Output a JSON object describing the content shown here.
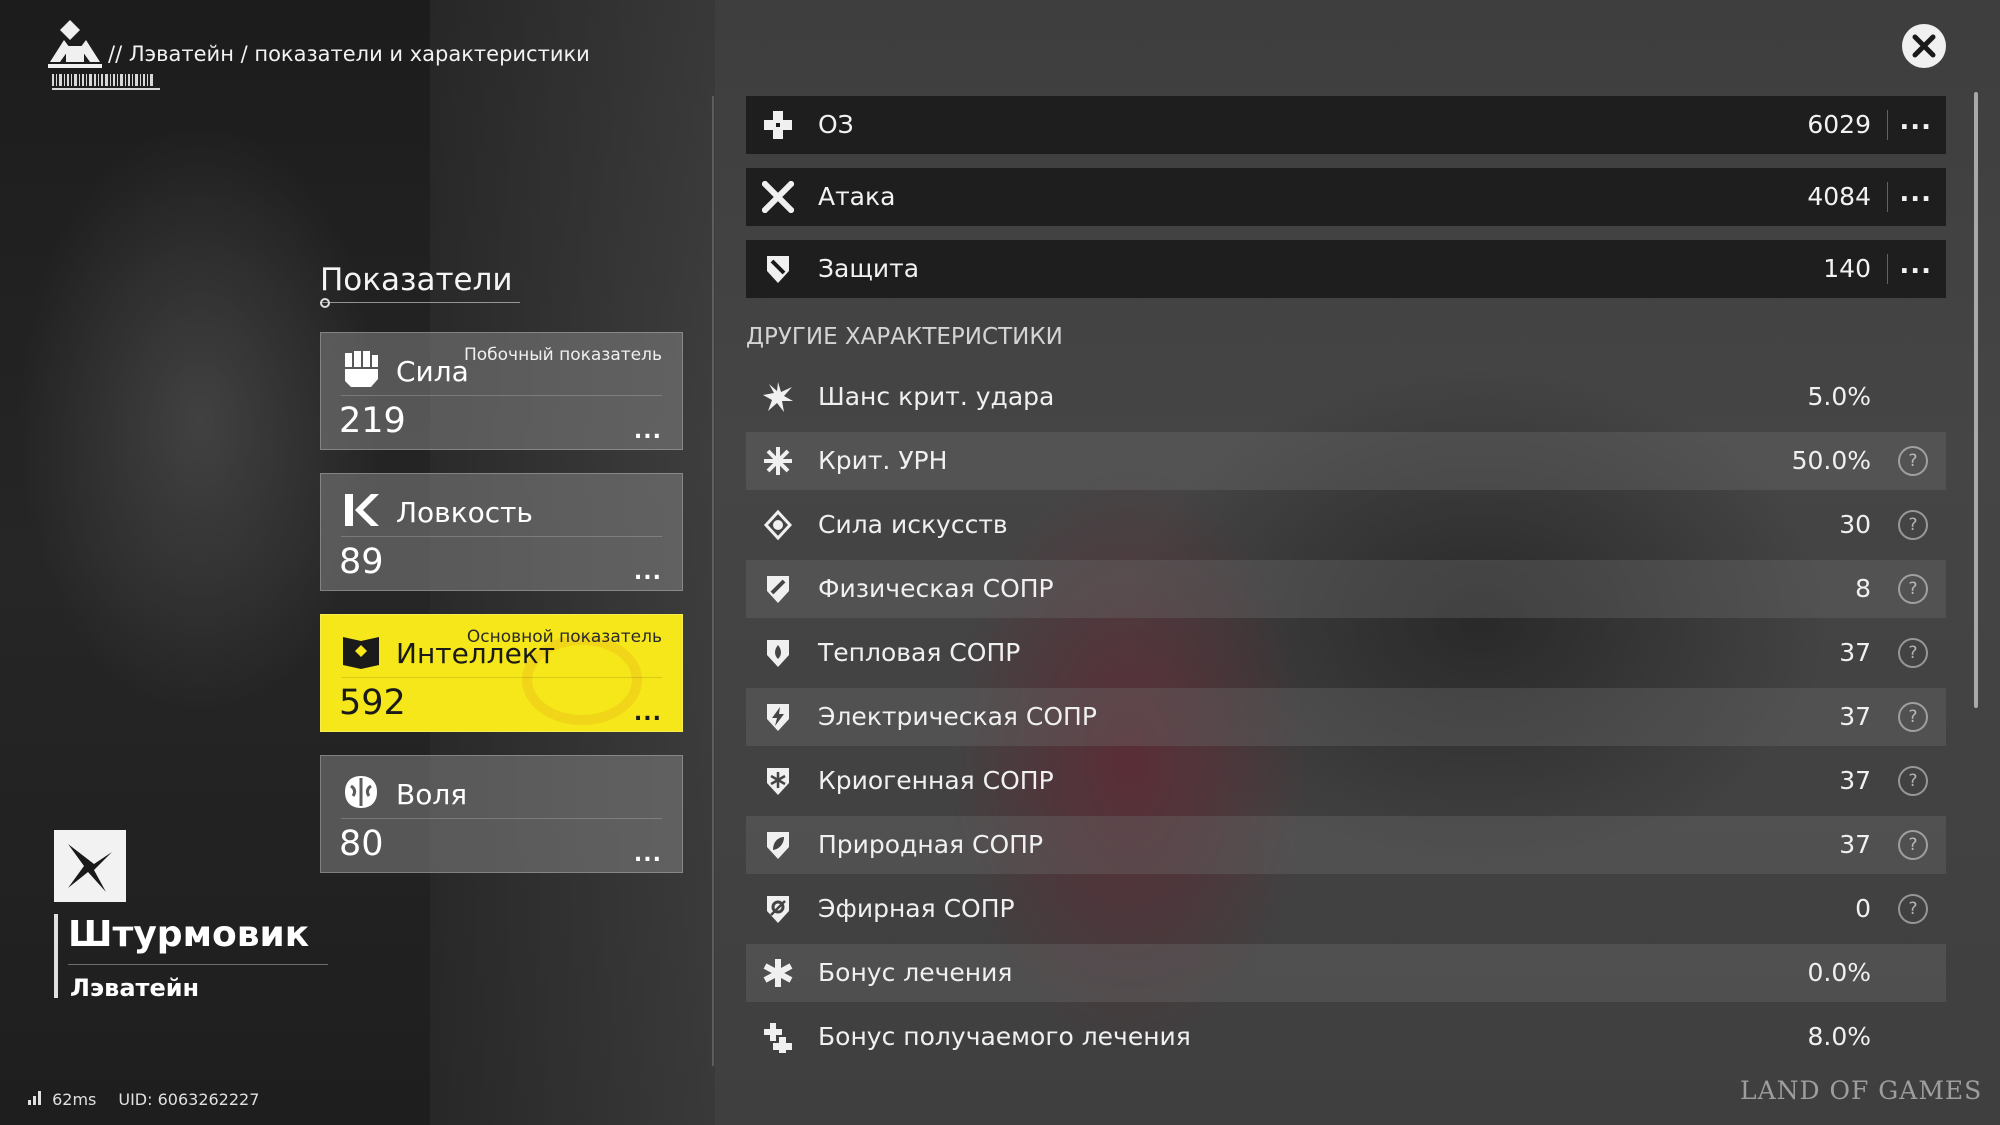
{
  "header": {
    "breadcrumb": "// Лэватейн / показатели и характеристики"
  },
  "character": {
    "class_name": "Штурмовик",
    "name": "Лэватейн"
  },
  "status_bar": {
    "ping": "62ms",
    "uid": "UID: 6063262227"
  },
  "attributes": {
    "title": "Показатели",
    "items": [
      {
        "name": "Сила",
        "value": "219",
        "tag": "Побочный показатель",
        "icon": "fist-icon",
        "more": "..."
      },
      {
        "name": "Ловкость",
        "value": "89",
        "tag": "",
        "icon": "agility-icon",
        "more": "..."
      },
      {
        "name": "Интеллект",
        "value": "592",
        "tag": "Основной показатель",
        "icon": "book-icon",
        "more": "..."
      },
      {
        "name": "Воля",
        "value": "80",
        "tag": "",
        "icon": "brain-icon",
        "more": "..."
      }
    ]
  },
  "main_stats": [
    {
      "label": "ОЗ",
      "value": "6029",
      "icon": "health-cross-icon",
      "more": "..."
    },
    {
      "label": "Атака",
      "value": "4084",
      "icon": "crossed-swords-icon",
      "more": "..."
    },
    {
      "label": "Защита",
      "value": "140",
      "icon": "shield-icon",
      "more": "..."
    }
  ],
  "other_stats": {
    "header": "ДРУГИЕ ХАРАКТЕРИСТИКИ",
    "help_symbol": "?",
    "items": [
      {
        "label": "Шанс крит. удара",
        "value": "5.0%",
        "icon": "crit-burst-icon",
        "help": false
      },
      {
        "label": "Крит. УРН",
        "value": "50.0%",
        "icon": "crit-damage-icon",
        "help": true
      },
      {
        "label": "Сила искусств",
        "value": "30",
        "icon": "arts-icon",
        "help": true
      },
      {
        "label": "Физическая СОПР",
        "value": "8",
        "icon": "physical-res-icon",
        "help": true
      },
      {
        "label": "Тепловая СОПР",
        "value": "37",
        "icon": "heat-res-icon",
        "help": true
      },
      {
        "label": "Электрическая СОПР",
        "value": "37",
        "icon": "electric-res-icon",
        "help": true
      },
      {
        "label": "Криогенная СОПР",
        "value": "37",
        "icon": "cryo-res-icon",
        "help": true
      },
      {
        "label": "Природная СОПР",
        "value": "37",
        "icon": "nature-res-icon",
        "help": true
      },
      {
        "label": "Эфирная СОПР",
        "value": "0",
        "icon": "ether-res-icon",
        "help": true
      },
      {
        "label": "Бонус лечения",
        "value": "0.0%",
        "icon": "heal-bonus-icon",
        "help": false
      },
      {
        "label": "Бонус получаемого лечения",
        "value": "8.0%",
        "icon": "received-heal-icon",
        "help": false
      }
    ]
  },
  "watermark": "LAND OF GAMES",
  "colors": {
    "primary_attribute": "#f5e71a",
    "panel_dark": "#191919"
  }
}
